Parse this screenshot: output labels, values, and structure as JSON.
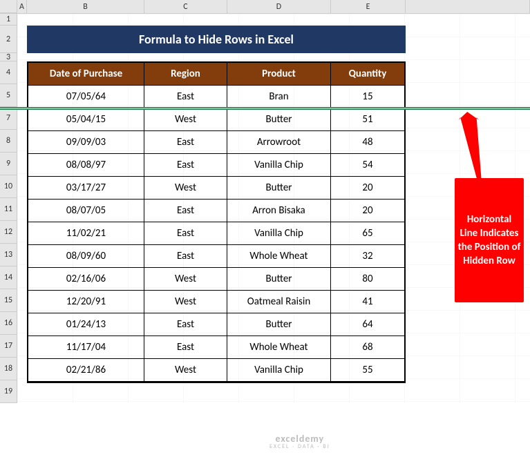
{
  "columns": [
    "A",
    "B",
    "C",
    "D",
    "E"
  ],
  "row_numbers_visible": [
    1,
    2,
    3,
    4,
    5,
    7,
    8,
    9,
    10,
    11,
    12,
    13,
    14,
    15,
    16,
    17,
    18,
    19
  ],
  "title": "Formula to Hide Rows in Excel",
  "table": {
    "headers": [
      "Date of Purchase",
      "Region",
      "Product",
      "Quantity"
    ],
    "rows": [
      {
        "date": "07/05/64",
        "region": "East",
        "product": "Bran",
        "qty": "15"
      },
      {
        "date": "05/04/15",
        "region": "West",
        "product": "Butter",
        "qty": "51"
      },
      {
        "date": "09/09/03",
        "region": "East",
        "product": "Arrowroot",
        "qty": "48"
      },
      {
        "date": "08/08/97",
        "region": "East",
        "product": "Vanilla Chip",
        "qty": "54"
      },
      {
        "date": "03/17/27",
        "region": "West",
        "product": "Butter",
        "qty": "20"
      },
      {
        "date": "08/07/05",
        "region": "East",
        "product": "Arron Bisaka",
        "qty": "20"
      },
      {
        "date": "11/02/21",
        "region": "East",
        "product": "Vanilla Chip",
        "qty": "65"
      },
      {
        "date": "08/09/60",
        "region": "East",
        "product": "Whole Wheat",
        "qty": "32"
      },
      {
        "date": "02/16/06",
        "region": "West",
        "product": "Butter",
        "qty": "80"
      },
      {
        "date": "12/20/91",
        "region": "West",
        "product": "Oatmeal Raisin",
        "qty": "41"
      },
      {
        "date": "01/24/13",
        "region": "East",
        "product": "Butter",
        "qty": "64"
      },
      {
        "date": "11/17/04",
        "region": "East",
        "product": "Whole Wheat",
        "qty": "68"
      },
      {
        "date": "02/21/86",
        "region": "West",
        "product": "Vanilla Chip",
        "qty": "55"
      }
    ]
  },
  "hidden_row_after_index": 0,
  "callout_text": "Horizontal Line Indicates the Position of Hidden Row",
  "watermark": {
    "line1": "exceldemy",
    "line2": "EXCEL · DATA · BI"
  }
}
